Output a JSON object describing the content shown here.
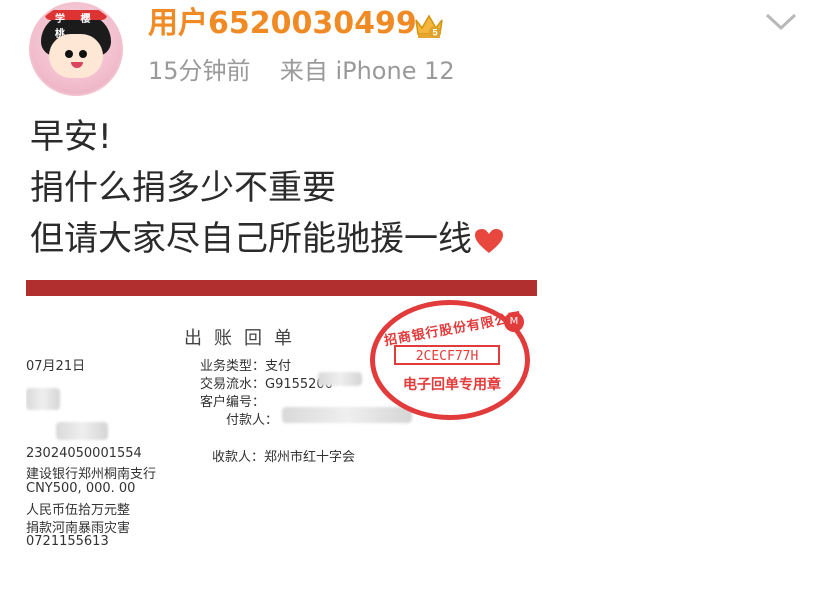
{
  "header": {
    "avatar_text": "学 樱 桃",
    "username": "用户6520030499",
    "vip_level": "5",
    "timestamp": "15分钟前",
    "source": "来自 iPhone 12"
  },
  "post": {
    "lines": [
      "早安!",
      "捐什么捐多少不重要",
      "但请大家尽自己所能驰援一线"
    ]
  },
  "receipt": {
    "title": "出账回单",
    "date": "07月21日",
    "business_type": "业务类型：支付",
    "serial": "交易流水：G9155200",
    "customer_no_label": "客户编号：",
    "payer_label": "付款人：",
    "account": "23024050001554",
    "payee": "收款人：郑州市红十字会",
    "bank": "建设银行郑州桐南支行",
    "amount": "CNY500, 000. 00",
    "amount_words": "人民币伍拾万元整",
    "purpose": "捐款河南暴雨灾害",
    "ref": "0721155613",
    "stamp_top": "招商银行股份有限公司",
    "stamp_code": "2CECF77H",
    "stamp_bottom": "电子回单专用章"
  },
  "colors": {
    "username": "#f08a24",
    "stamp": "#e23b3b",
    "receipt_bar": "#b12f2f"
  }
}
